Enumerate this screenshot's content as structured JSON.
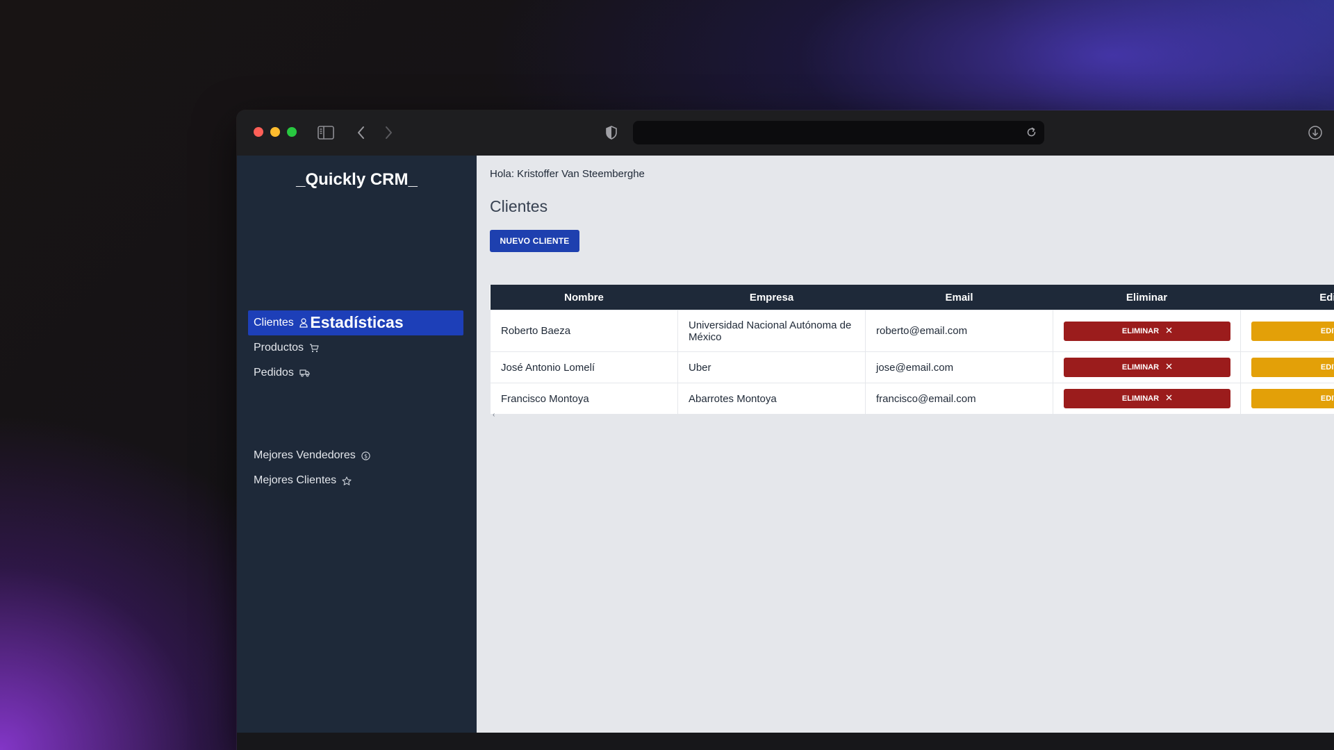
{
  "browser": {
    "url": "",
    "icons": [
      "sidebar-toggle-icon",
      "back-icon",
      "forward-icon",
      "shield-icon",
      "reload-icon",
      "download-icon"
    ]
  },
  "sidebar": {
    "brand": "_Quickly CRM_",
    "items": [
      {
        "label": "Clientes",
        "icon": "user-icon",
        "active": true
      },
      {
        "label": "Productos",
        "icon": "cart-icon",
        "active": false
      },
      {
        "label": "Pedidos",
        "icon": "truck-icon",
        "active": false
      }
    ],
    "stats_title": "Estadísticas",
    "stats_items": [
      {
        "label": "Mejores Vendedores",
        "icon": "dollar-icon"
      },
      {
        "label": "Mejores Clientes",
        "icon": "star-icon"
      }
    ]
  },
  "main": {
    "greeting": "Hola: Kristoffer Van Steemberghe",
    "title": "Clientes",
    "new_button": "NUEVO CLIENTE",
    "table": {
      "headers": [
        "Nombre",
        "Empresa",
        "Email",
        "Eliminar",
        "Editar"
      ],
      "rows": [
        {
          "nombre": "Roberto Baeza",
          "empresa": "Universidad Nacional Autónoma de México",
          "email": "roberto@email.com"
        },
        {
          "nombre": "José Antonio Lomelí",
          "empresa": "Uber",
          "email": "jose@email.com"
        },
        {
          "nombre": "Francisco Montoya",
          "empresa": "Abarrotes Montoya",
          "email": "francisco@email.com"
        }
      ],
      "delete_label": "ELIMINAR",
      "edit_label": "EDITAR"
    }
  },
  "colors": {
    "sidebar_bg": "#1e2939",
    "active_item": "#1d3fb8",
    "primary_button": "#1e40af",
    "delete_button": "#9b1c1c",
    "edit_button": "#e3a008",
    "content_bg": "#e5e7eb"
  }
}
